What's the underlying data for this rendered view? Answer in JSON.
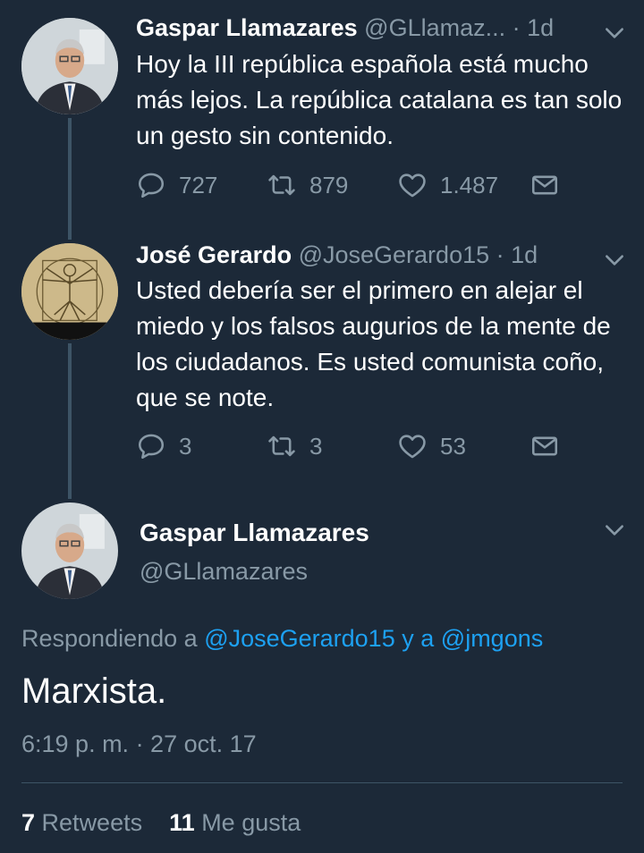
{
  "tweets": [
    {
      "name": "Gaspar Llamazares",
      "handle": "@GLlamaz...",
      "time": "1d",
      "text": "Hoy la III república española está mucho más lejos. La república catalana es tan solo un gesto sin contenido.",
      "replies": "727",
      "retweets": "879",
      "likes": "1.487"
    },
    {
      "name": "José Gerardo",
      "handle": "@JoseGerardo15",
      "time": "1d",
      "text": "Usted debería ser el primero en alejar el miedo y los falsos augurios de la mente de los ciudadanos. Es usted comunista coño, que se note.",
      "replies": "3",
      "retweets": "3",
      "likes": "53"
    }
  ],
  "main_tweet": {
    "name": "Gaspar Llamazares",
    "handle": "@GLlamazares",
    "reply_prefix": "Respondiendo a",
    "reply_mention_1": "@JoseGerardo15",
    "reply_joiner": "y a",
    "reply_mention_2": "@jmgons",
    "text": "Marxista.",
    "timestamp": "6:19 p. m. · 27 oct. 17",
    "retweet_count": "7",
    "retweet_label": "Retweets",
    "like_count": "11",
    "like_label": "Me gusta"
  },
  "icons": {
    "reply": "reply-icon",
    "retweet": "retweet-icon",
    "like": "heart-icon",
    "dm": "envelope-icon",
    "menu": "chevron-down-icon"
  },
  "colors": {
    "background": "#1c2938",
    "secondary_text": "#8899a6",
    "link": "#1da1f2",
    "thread_line": "#3d5466"
  }
}
